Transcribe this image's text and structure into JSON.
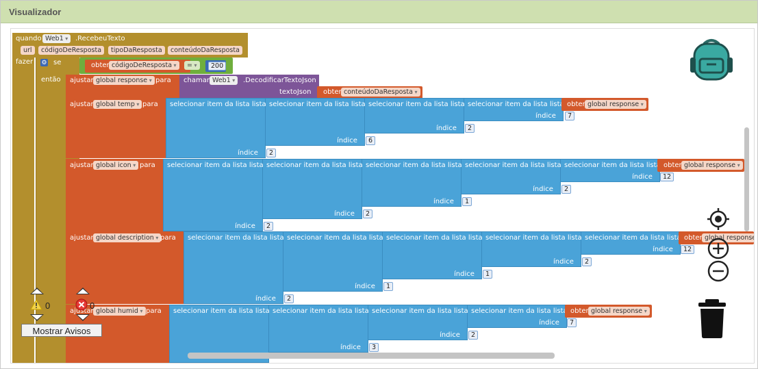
{
  "title": "Visualizador",
  "event": {
    "quando": "quando",
    "component": "Web1",
    "event_name": ".RecebeuTexto",
    "params": [
      "url",
      "códigoDeResposta",
      "tipoDaResposta",
      "conteúdoDaResposta"
    ],
    "fazer": "fazer",
    "se": "se",
    "entao": "então"
  },
  "condition": {
    "obter": "obter",
    "var": "códigoDeResposta",
    "op": "=",
    "value": "200"
  },
  "set_response": {
    "ajustar": "ajustar",
    "var": "global response",
    "para": "para",
    "chamar": "chamar",
    "component": "Web1",
    "method": ".DecodificarTextoJson",
    "arg_label": "textoJson",
    "obter": "obter",
    "arg_var": "conteúdoDaResposta"
  },
  "select_label": "selecionar item da lista  lista",
  "indice_label": "índice",
  "get_label": "obter",
  "get_var": "global response",
  "set_blocks": [
    {
      "ajustar": "ajustar",
      "var": "global temp",
      "para": "para",
      "indices": [
        "7",
        "2",
        "6",
        "2"
      ]
    },
    {
      "ajustar": "ajustar",
      "var": "global icon",
      "para": "para",
      "indices": [
        "12",
        "2",
        "1",
        "2",
        "2"
      ]
    },
    {
      "ajustar": "ajustar",
      "var": "global description",
      "para": "para",
      "indices": [
        "12",
        "2",
        "1",
        "1",
        "2"
      ]
    },
    {
      "ajustar": "ajustar",
      "var": "global humid",
      "para": "para",
      "indices": [
        "7",
        "2",
        "3"
      ]
    }
  ],
  "warnings": {
    "count": "0"
  },
  "errors": {
    "count": "0"
  },
  "show_warnings_button": "Mostrar Avisos",
  "icons": [
    "backpack-icon",
    "recenter-icon",
    "zoom-in-icon",
    "zoom-out-icon",
    "trash-icon",
    "warning-icon",
    "error-icon"
  ]
}
